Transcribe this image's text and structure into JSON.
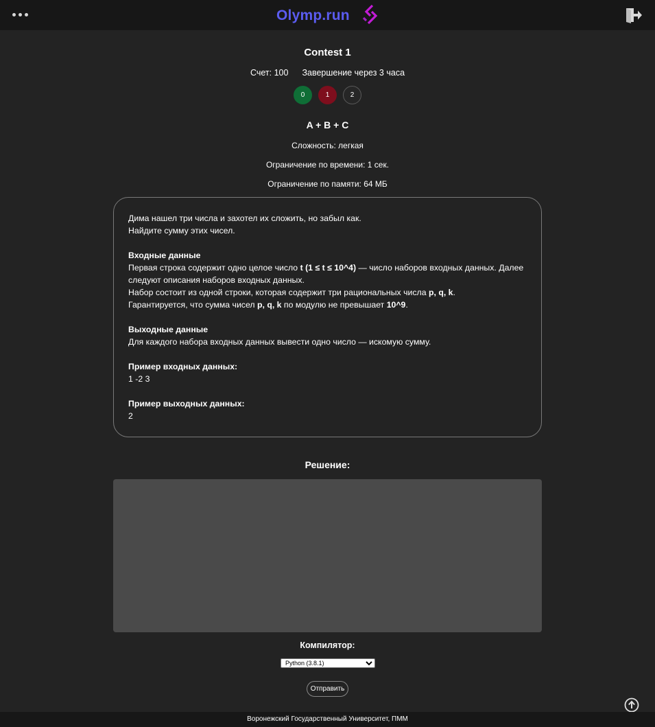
{
  "header": {
    "logo_text": "Olymp.run",
    "menu_icon": "more-dots-icon",
    "exit_icon": "logout-door-icon",
    "logo_colors": {
      "text": "#5b5cf0",
      "mark": "#c21bd6"
    }
  },
  "contest": {
    "title": "Contest 1",
    "score": "Счет: 100",
    "ends": "Завершение через 3 часа",
    "problems": [
      {
        "label": "0",
        "status": "accepted",
        "color": "#0f6e36"
      },
      {
        "label": "1",
        "status": "wrong",
        "color": "#7e0e1d"
      },
      {
        "label": "2",
        "status": "not_attempted",
        "color": "#262626"
      }
    ]
  },
  "problem": {
    "title": "A + B + C",
    "difficulty": "Сложность: легкая",
    "time_limit": "Ограничение по времени: 1 сек.",
    "memory_limit": "Ограничение по памяти: 64 МБ",
    "statement": {
      "intro_1": "Дима нашел три числа и захотел их сложить, но забыл как.",
      "intro_2": "Найдите сумму этих чисел.",
      "input_title": "Входные данные",
      "input_1_pre": "Первая строка содержит одно целое число ",
      "input_1_bold": "t (1 ≤ t ≤ 10^4)",
      "input_1_post": " — число наборов входных данных. Далее следуют описания наборов входных данных.",
      "input_2_pre": "Набор состоит из одной строки, которая содержит три рациональных числа ",
      "input_2_bold": "p, q, k",
      "input_2_post": ".",
      "input_3_pre": "Гарантируется, что сумма чисел ",
      "input_3_bold": "p, q, k",
      "input_3_mid": " по модулю не превышает ",
      "input_3_bold2": "10^9",
      "input_3_post": ".",
      "output_title": "Выходные данные",
      "output_1": "Для каждого набора входных данных вывести одно число — искомую сумму.",
      "sample_in_title": "Пример входных данных:",
      "sample_in": "1 -2 3",
      "sample_out_title": "Пример выходных данных:",
      "sample_out": "2"
    }
  },
  "solution": {
    "title": "Решение:",
    "code": "",
    "compiler_label": "Компилятор:",
    "compiler_selected": "Python (3.8.1)",
    "submit_label": "Отправить",
    "scroll_top_icon": "arrow-up-circle-icon"
  },
  "footer": {
    "text": "Воронежский Государственный Университет, ПММ"
  }
}
